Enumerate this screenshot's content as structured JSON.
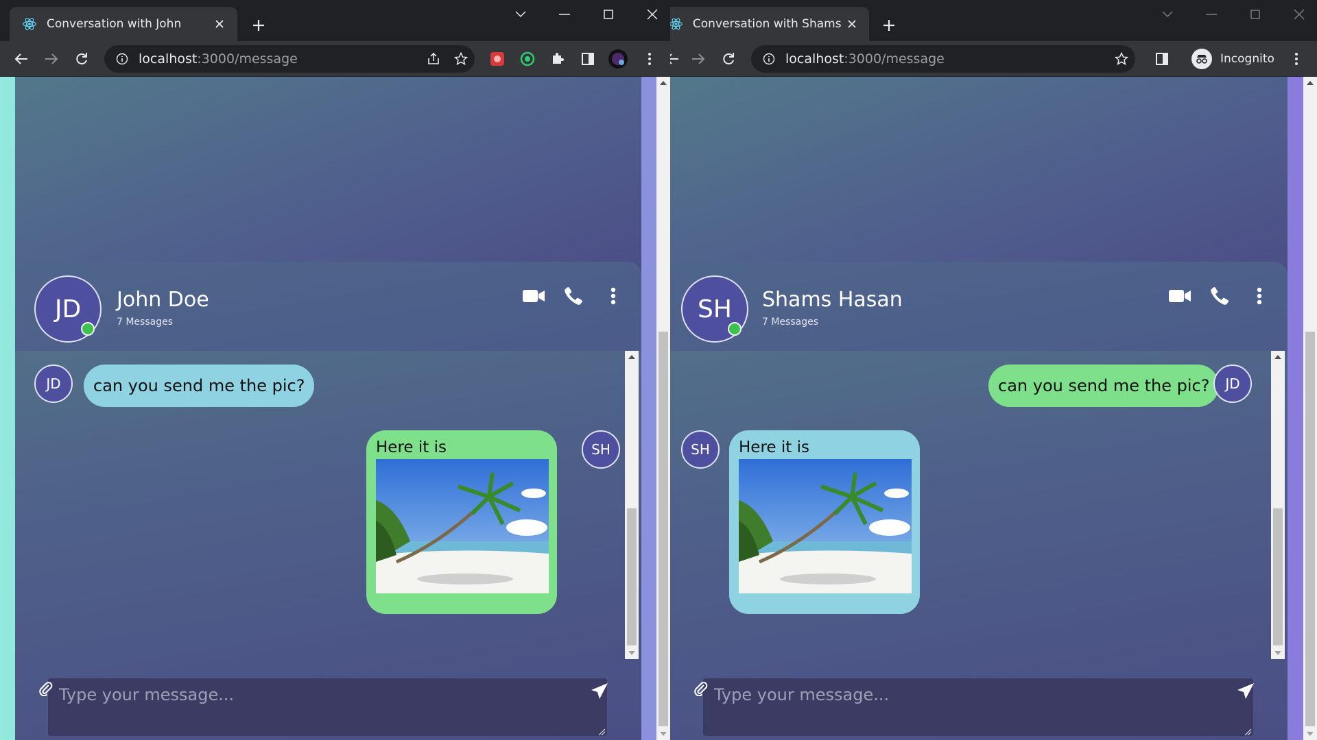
{
  "windows": [
    {
      "tab_title": "Conversation with John",
      "url_host": "localhost",
      "url_rest": ":3000/message",
      "contact": {
        "initials": "JD",
        "name": "John Doe",
        "subtitle": "7 Messages"
      },
      "messages": [
        {
          "from_initials": "JD",
          "side": "incoming",
          "text": "can you send me the pic?"
        },
        {
          "from_initials": "SH",
          "side": "outgoing",
          "caption": "Here it is",
          "has_image": true
        }
      ],
      "composer_placeholder": "Type your message..."
    },
    {
      "tab_title": "Conversation with Shams",
      "url_host": "localhost",
      "url_rest": ":3000/message",
      "incognito_label": "Incognito",
      "contact": {
        "initials": "SH",
        "name": "Shams Hasan",
        "subtitle": "7 Messages"
      },
      "messages": [
        {
          "from_initials": "JD",
          "side": "outgoing",
          "text": "can you send me the pic?"
        },
        {
          "from_initials": "SH",
          "side": "incoming",
          "caption": "Here it is",
          "has_image": true
        }
      ],
      "composer_placeholder": "Type your message..."
    }
  ],
  "colors": {
    "sent_bubble": "#7ee08a",
    "received_bubble": "#8fd3e3",
    "online_dot": "#3ec24f",
    "avatar": "#4e4f9f"
  },
  "icons": [
    "react-icon",
    "close-icon",
    "plus-icon",
    "back-icon",
    "forward-icon",
    "reload-icon",
    "info-icon",
    "share-icon",
    "star-icon",
    "extensions-icon",
    "side-panel-icon",
    "menu-icon",
    "video-icon",
    "phone-icon",
    "more-icon",
    "paperclip-icon",
    "send-icon",
    "incognito-icon"
  ]
}
